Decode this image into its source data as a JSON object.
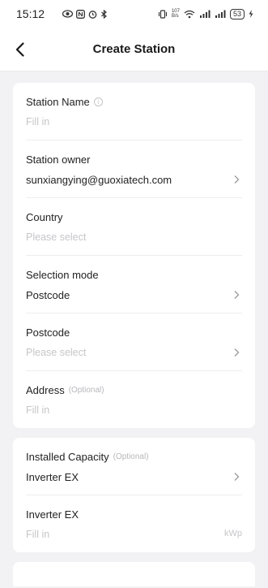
{
  "status": {
    "time": "15:12",
    "speed_top": "107",
    "speed_bottom": "B/s",
    "battery": "53"
  },
  "nav": {
    "title": "Create Station"
  },
  "form": {
    "station_name": {
      "label": "Station Name",
      "placeholder": "Fill in"
    },
    "station_owner": {
      "label": "Station owner",
      "value": "sunxiangying@guoxiatech.com"
    },
    "country": {
      "label": "Country",
      "placeholder": "Please select"
    },
    "selection_mode": {
      "label": "Selection mode",
      "value": "Postcode"
    },
    "postcode": {
      "label": "Postcode",
      "placeholder": "Please select"
    },
    "address": {
      "label": "Address",
      "optional": "(Optional)",
      "placeholder": "Fill in"
    }
  },
  "capacity": {
    "installed_capacity": {
      "label": "Installed Capacity",
      "optional": "(Optional)",
      "value": "Inverter EX"
    },
    "inverter_ex": {
      "label": "Inverter EX",
      "placeholder": "Fill in",
      "unit": "kWp"
    }
  }
}
